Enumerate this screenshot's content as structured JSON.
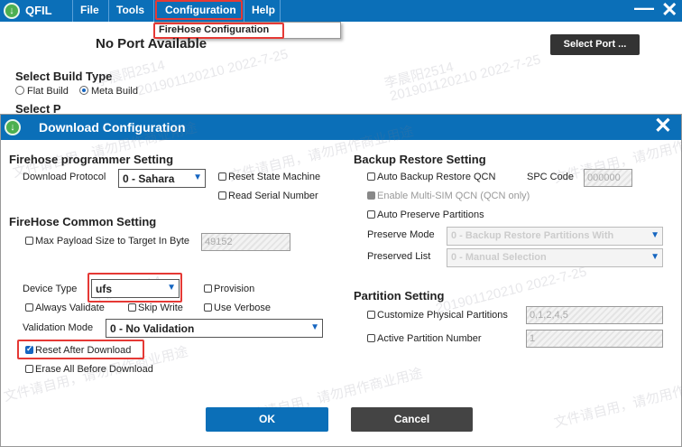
{
  "app": {
    "name": "QFIL",
    "menu": [
      "File",
      "Tools",
      "Configuration",
      "Help"
    ],
    "window_controls": {
      "minimize": "—",
      "close": "✕"
    },
    "dropdown_item": "FireHose Configuration",
    "port_status": "No Port Available",
    "select_port_label": "Select Port ...",
    "build_section_title": "Select Build Type",
    "build_options": [
      {
        "label": "Flat Build",
        "selected": false
      },
      {
        "label": "Meta Build",
        "selected": true
      }
    ],
    "cut_off_heading": "Select P"
  },
  "dialog": {
    "title": "Download Configuration",
    "close": "✕",
    "firehose_programmer": {
      "heading": "Firehose programmer Setting",
      "protocol_label": "Download Protocol",
      "protocol_value": "0 - Sahara",
      "reset_state_machine": "Reset State Machine",
      "read_serial_number": "Read Serial Number"
    },
    "firehose_common": {
      "heading": "FireHose Common Setting",
      "max_payload_label": "Max Payload Size to Target In Byte",
      "max_payload_value": "49152",
      "device_type_label": "Device Type",
      "device_type_value": "ufs",
      "provision": "Provision",
      "always_validate": "Always Validate",
      "skip_write": "Skip Write",
      "use_verbose": "Use Verbose",
      "validation_mode_label": "Validation Mode",
      "validation_mode_value": "0 - No Validation",
      "reset_after_download": "Reset After Download",
      "erase_all_before_download": "Erase All Before Download"
    },
    "backup_restore": {
      "heading": "Backup Restore Setting",
      "auto_backup_restore_qcn": "Auto Backup Restore QCN",
      "spc_code_label": "SPC Code",
      "spc_code_value": "000000",
      "enable_multi_sim": "Enable Multi-SIM QCN (QCN only)",
      "auto_preserve_partitions": "Auto Preserve Partitions",
      "preserve_mode_label": "Preserve Mode",
      "preserve_mode_value": "0 - Backup Restore Partitions With",
      "preserved_list_label": "Preserved List",
      "preserved_list_value": "0 - Manual Selection"
    },
    "partition": {
      "heading": "Partition Setting",
      "customize_physical_partitions": "Customize Physical Partitions",
      "physical_partitions_value": "0,1,2,4,5",
      "active_partition_number": "Active Partition Number",
      "active_partition_value": "1"
    },
    "buttons": {
      "ok": "OK",
      "cancel": "Cancel"
    }
  },
  "watermarks": [
    "李晨阳2514",
    "201901120210 2022-7-25",
    "文件请自用，请勿用作商业用途"
  ],
  "colors": {
    "title_bar": "#0b6fb8",
    "highlight": "#e53935",
    "ok_button": "#0b6fb8",
    "cancel_button": "#444444",
    "check_accent": "#1565c0"
  }
}
